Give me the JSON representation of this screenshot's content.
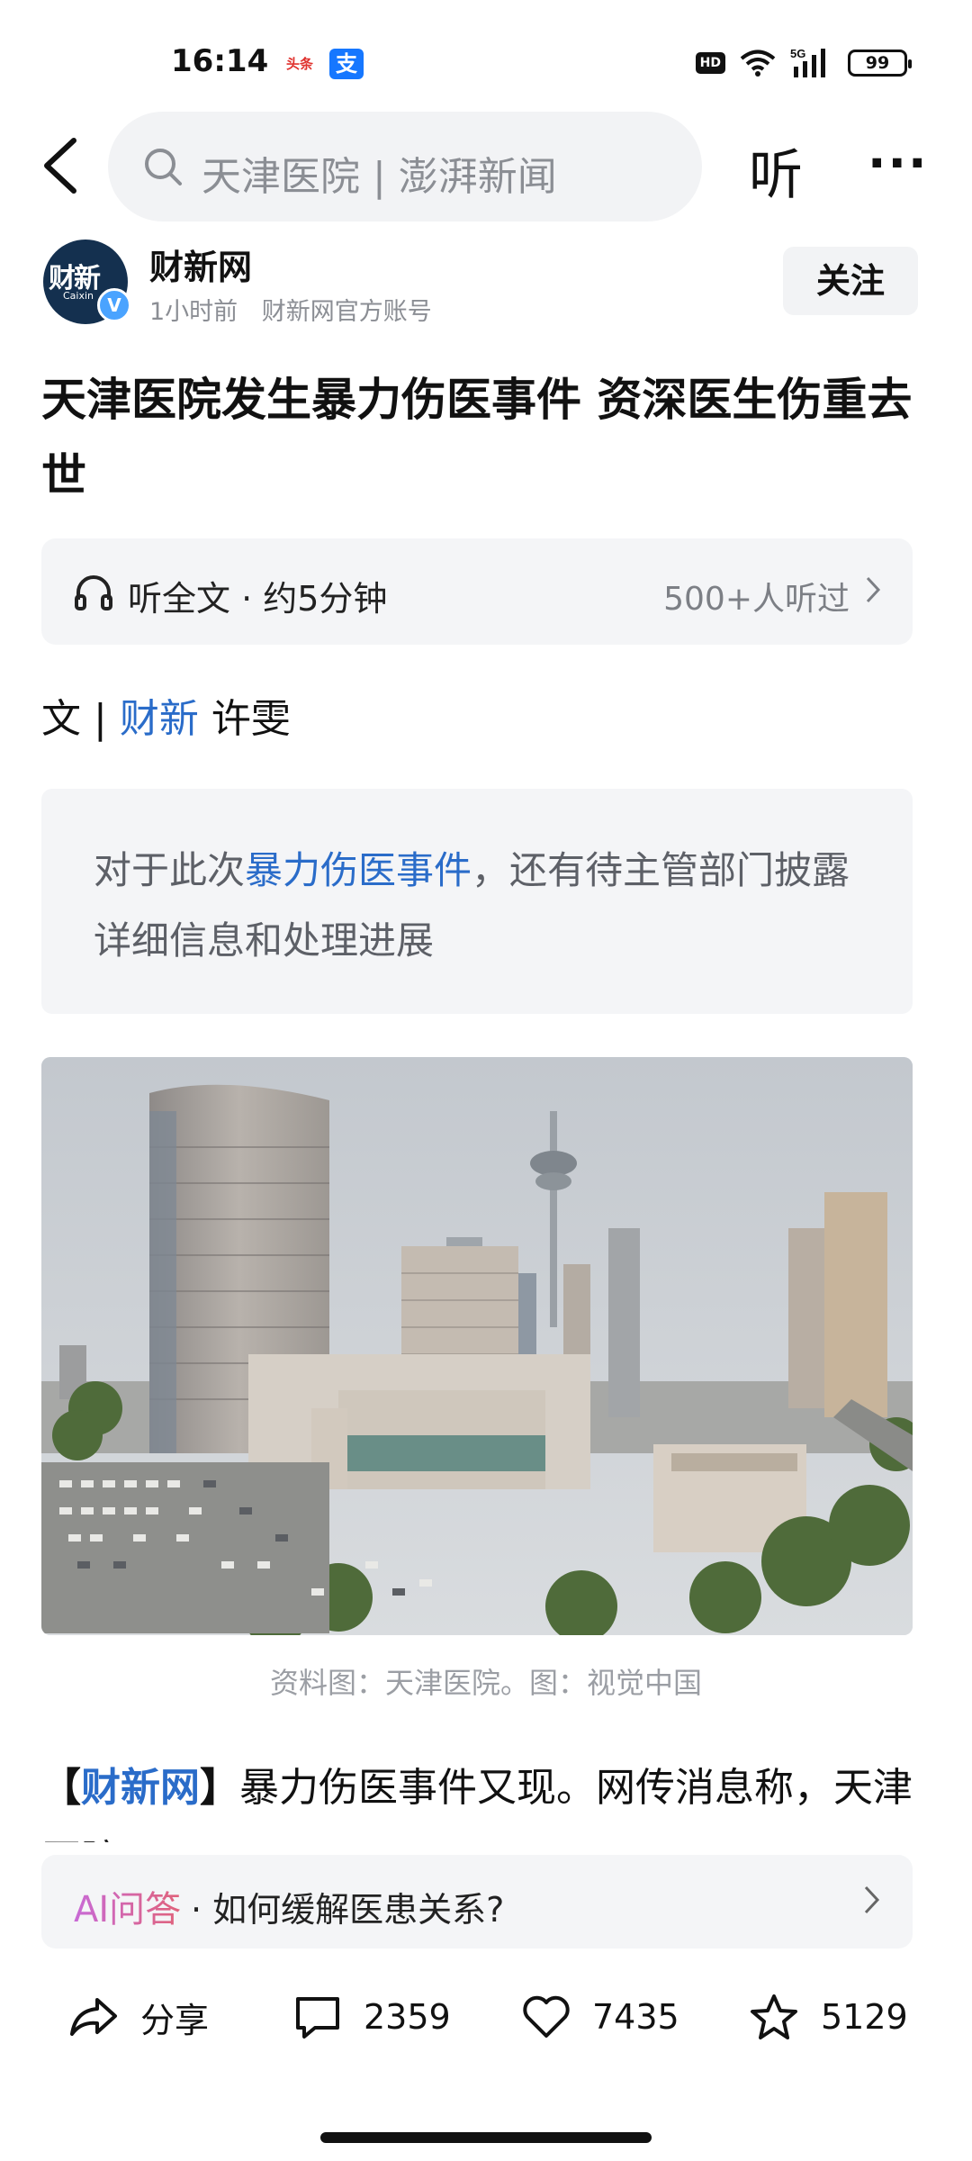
{
  "status_bar": {
    "time": "16:14",
    "app_badges": [
      "头条",
      "支"
    ],
    "network": "5G",
    "hd": "HD",
    "battery": "99"
  },
  "top_bar": {
    "search_text": "天津医院 | 澎湃新闻",
    "listen_label": "听",
    "more_label": "···"
  },
  "author": {
    "avatar_text": "财新",
    "avatar_sub": "Caixin",
    "verified_mark": "V",
    "name": "财新网",
    "time_ago": "1小时前",
    "account_type": "财新网官方账号",
    "follow_label": "关注"
  },
  "article": {
    "title": "天津医院发生暴力伤医事件 资深医生伤重去世",
    "listen_bar": {
      "label": "听全文 · 约5分钟",
      "count": "500+人听过"
    },
    "byline": {
      "prefix": "文",
      "separator": "|",
      "source": "财新",
      "author": "许雯"
    },
    "summary": {
      "before": "对于此次",
      "link": "暴力伤医事件",
      "after": "，还有待主管部门披露详细信息和处理进展"
    },
    "photo_caption": "资料图：天津医院。图：视觉中国",
    "body": {
      "bracket_open": "【",
      "source": "财新网",
      "bracket_close": "】",
      "text": "暴力伤医事件又现。网传消息称，天津医院"
    }
  },
  "ai_bar": {
    "tag": "AI问答",
    "question": "· 如何缓解医患关系?"
  },
  "bottom_bar": {
    "share_label": "分享",
    "comments": "2359",
    "likes": "7435",
    "favorites": "5129"
  },
  "colors": {
    "link_blue": "#2a6cc9",
    "panel_gray": "#f4f5f7",
    "muted_text": "#8b8e94"
  }
}
